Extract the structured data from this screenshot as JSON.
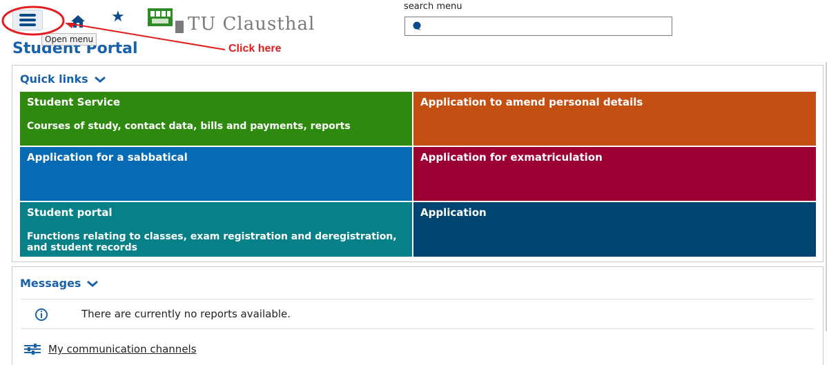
{
  "header": {
    "search_label": "search menu",
    "search_value": "",
    "logo_text": "TU Clausthal",
    "tooltip": "Open menu",
    "page_title": "Student Portal"
  },
  "annotation": {
    "text": "Click here",
    "color": "#e11d1d"
  },
  "icons": {
    "menu": "hamburger-menu-icon",
    "home": "home-icon",
    "favorites": "star-icon",
    "search": "search-bubble-icon",
    "collapse": "chevron-down-icon",
    "info": "info-icon",
    "channels": "sliders-icon"
  },
  "quick_links": {
    "title": "Quick links",
    "tiles": [
      {
        "title": "Student Service",
        "desc": "Courses of study, contact data, bills and payments, reports",
        "color": "#2e8a0e"
      },
      {
        "title": "Application to amend personal details",
        "desc": "",
        "color": "#c44f12"
      },
      {
        "title": "Application for a sabbatical",
        "desc": "",
        "color": "#066bb4"
      },
      {
        "title": "Application for exmatriculation",
        "desc": "",
        "color": "#9c0033"
      },
      {
        "title": "Student portal",
        "desc": "Functions relating to classes, exam registration and deregistration, and student records",
        "color": "#078187"
      },
      {
        "title": "Application",
        "desc": "",
        "color": "#004470"
      }
    ]
  },
  "messages": {
    "title": "Messages",
    "empty_text": "There are currently no reports available.",
    "channels_link": "My communication channels"
  },
  "colors": {
    "link_blue": "#1961a8",
    "annotation_red": "#e11d1d"
  }
}
